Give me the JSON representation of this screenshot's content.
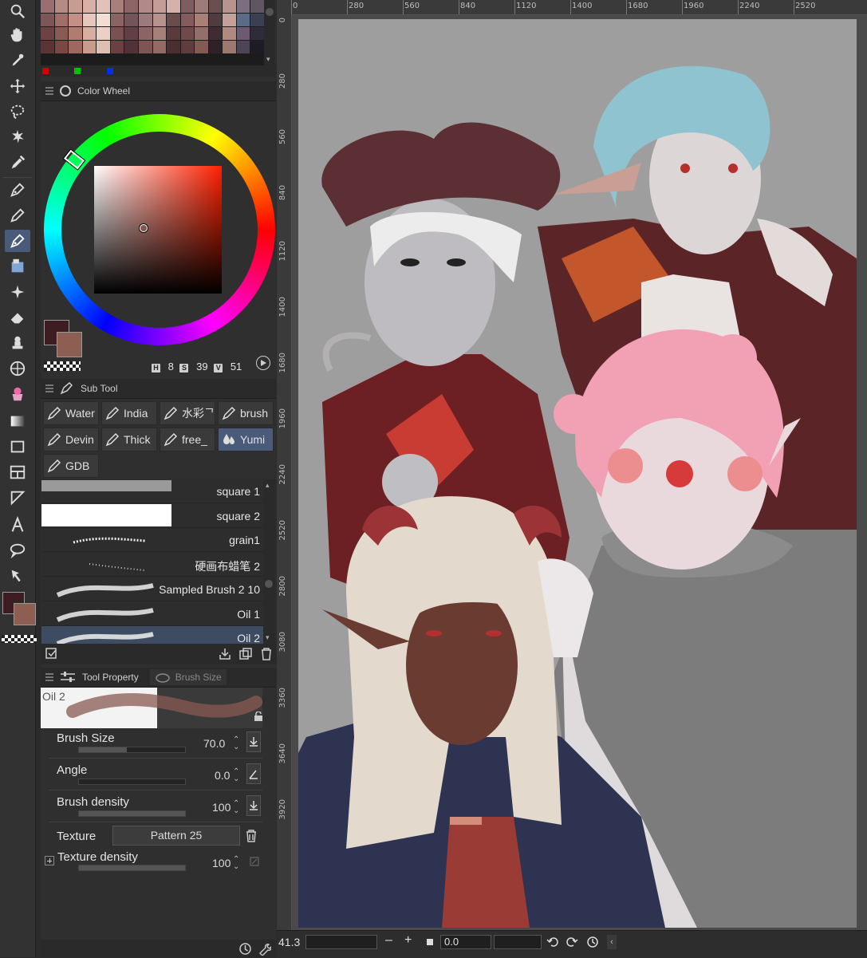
{
  "palette": {
    "colors": [
      "#9a6f6f",
      "#b58b86",
      "#c79c93",
      "#d8b0a8",
      "#e2c2b8",
      "#a87f7a",
      "#8d6566",
      "#b08988",
      "#c59d98",
      "#d4b1aa",
      "#7d5d5f",
      "#9d7b78",
      "#6b4e52",
      "#b7958e",
      "#7a6e80",
      "#5e5660",
      "#7f5656",
      "#a26e6a",
      "#c48f86",
      "#e5c7be",
      "#f1ddd3",
      "#8a6464",
      "#735458",
      "#9a7a7a",
      "#b8928c",
      "#6b4c4c",
      "#845c5d",
      "#a88077",
      "#4f3b40",
      "#c3a198",
      "#5a6b8a",
      "#3a4052",
      "#6e4243",
      "#8c5a55",
      "#b07c72",
      "#d8aea1",
      "#ead0c5",
      "#7b5052",
      "#623f45",
      "#8c6466",
      "#a78078",
      "#5b3a3d",
      "#704a4b",
      "#946e68",
      "#3f2c33",
      "#b08a80",
      "#6d5a72",
      "#2f2c3a",
      "#5c3436",
      "#7a4745",
      "#9e6860",
      "#c89b8c",
      "#dfbfb2",
      "#6a4043",
      "#513238",
      "#7c5555",
      "#946b64",
      "#4a2e32",
      "#5f3c3d",
      "#835a54",
      "#2e2228",
      "#9c7870",
      "#4e4457",
      "#1e1b24"
    ],
    "primaries": [
      "#d00000",
      "#00c000",
      "#0030e0"
    ]
  },
  "color_wheel": {
    "title": "Color Wheel",
    "h": "8",
    "s": "39",
    "v": "51",
    "h_tag": "H",
    "s_tag": "S",
    "v_tag": "V",
    "main_color": "#3d1c22",
    "sub_color": "#8f5e52"
  },
  "sub_tool": {
    "title": "Sub Tool",
    "buttons": [
      "Water",
      "India",
      "水彩ᄀ",
      "brush",
      "Devin",
      "Thick",
      "free_",
      "Yumi",
      "GDB"
    ],
    "brushes": [
      {
        "name": "square 1"
      },
      {
        "name": "square 2"
      },
      {
        "name": "grain1"
      },
      {
        "name": "硬画布蜡笔 2"
      },
      {
        "name": "Sampled Brush 2 10"
      },
      {
        "name": "Oil 1"
      },
      {
        "name": "Oil 2"
      }
    ]
  },
  "tool_property": {
    "title": "Tool Property",
    "tab2": "Brush Size",
    "preview_name": "Oil 2",
    "brush_size_label": "Brush Size",
    "brush_size_value": "70.0",
    "brush_size_level": 0.45,
    "angle_label": "Angle",
    "angle_value": "0.0",
    "angle_level": 0.0,
    "density_label": "Brush density",
    "density_value": "100",
    "density_level": 1.0,
    "texture_label": "Texture",
    "texture_value": "Pattern 25",
    "texture_density_label": "Texture density",
    "texture_density_value": "100",
    "texture_density_level": 1.0
  },
  "ruler": {
    "top": [
      "0",
      "280",
      "560",
      "840",
      "1120",
      "1400",
      "1680",
      "1960",
      "2240",
      "2520"
    ],
    "left": [
      "0",
      "280",
      "560",
      "840",
      "1120",
      "1400",
      "1680",
      "1960",
      "2240",
      "2520",
      "2800",
      "3080",
      "3360",
      "3640",
      "3920"
    ]
  },
  "status": {
    "zoom": "41.3",
    "minus": "–",
    "plus": "+",
    "angle": "0.0"
  }
}
